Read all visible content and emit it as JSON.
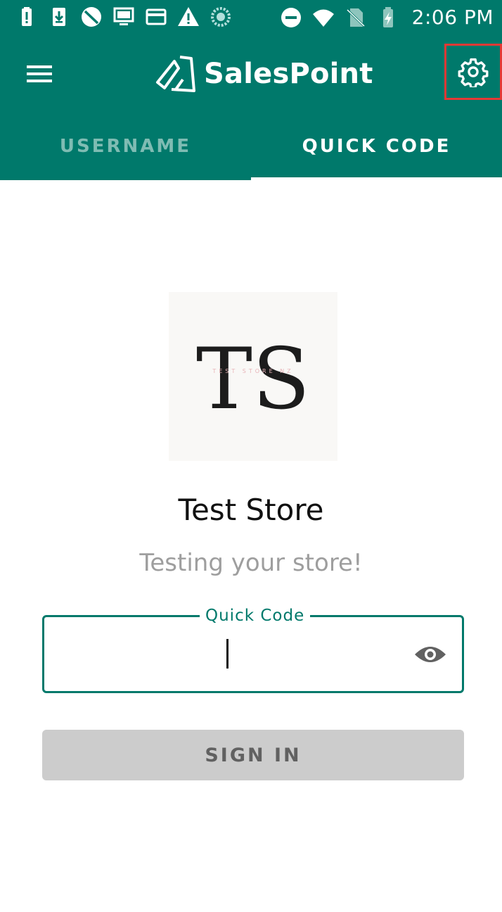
{
  "status_bar": {
    "time": "2:06 PM",
    "left_icons": [
      "battery-alert-icon",
      "download-icon",
      "do-not-disturb-icon",
      "monitor-icon",
      "card-icon",
      "warning-icon",
      "loading-icon"
    ],
    "right_icons": [
      "dnd-minus-icon",
      "wifi-icon",
      "no-sim-icon",
      "battery-charging-icon"
    ]
  },
  "app_bar": {
    "brand": "SalesPoint",
    "menu_icon": "hamburger-menu-icon",
    "settings_icon": "gear-icon"
  },
  "tabs": [
    {
      "label": "USERNAME",
      "active": false
    },
    {
      "label": "QUICK CODE",
      "active": true
    }
  ],
  "store": {
    "logo_text": "TS",
    "logo_subtext": "TEST STORE NZ",
    "name": "Test Store",
    "tagline": "Testing your store!"
  },
  "quick_code": {
    "label": "Quick Code",
    "value": "",
    "toggle_icon": "eye-icon"
  },
  "sign_in": {
    "label": "SIGN IN"
  },
  "colors": {
    "primary": "#00796b",
    "tab_inactive": "#7fbcb3",
    "highlight_border": "#e53935",
    "button_disabled": "#cccccc",
    "button_text": "#616161",
    "tagline": "#9e9e9e"
  }
}
